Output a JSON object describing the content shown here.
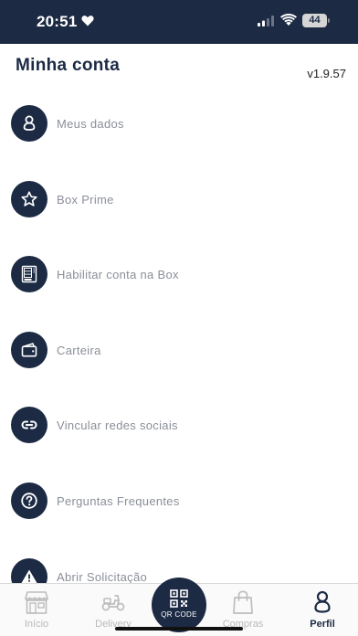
{
  "status_bar": {
    "time": "20:51",
    "battery": "44"
  },
  "header": {
    "title": "Minha conta",
    "version": "v1.9.57"
  },
  "menu": {
    "items": [
      {
        "label": "Meus dados",
        "icon": "person-icon"
      },
      {
        "label": "Box Prime",
        "icon": "star-icon"
      },
      {
        "label": "Habilitar conta na Box",
        "icon": "vending-machine-icon"
      },
      {
        "label": "Carteira",
        "icon": "wallet-icon"
      },
      {
        "label": "Vincular redes sociais",
        "icon": "link-icon"
      },
      {
        "label": "Perguntas Frequentes",
        "icon": "question-icon"
      },
      {
        "label": "Abrir Solicitação",
        "icon": "warning-icon"
      }
    ]
  },
  "bottom_nav": {
    "items": [
      {
        "label": "Início",
        "icon": "store-icon"
      },
      {
        "label": "Delivery",
        "icon": "scooter-icon"
      },
      {
        "label": "Compras",
        "icon": "shopping-bag-icon"
      },
      {
        "label": "Perfil",
        "icon": "person-icon",
        "active": true
      }
    ],
    "qr": {
      "label": "QR CODE",
      "icon": "qr-code-icon"
    }
  },
  "colors": {
    "primary": "#1c2a44",
    "muted_text": "#8a8f98",
    "inactive_nav": "#b9b9b9"
  }
}
